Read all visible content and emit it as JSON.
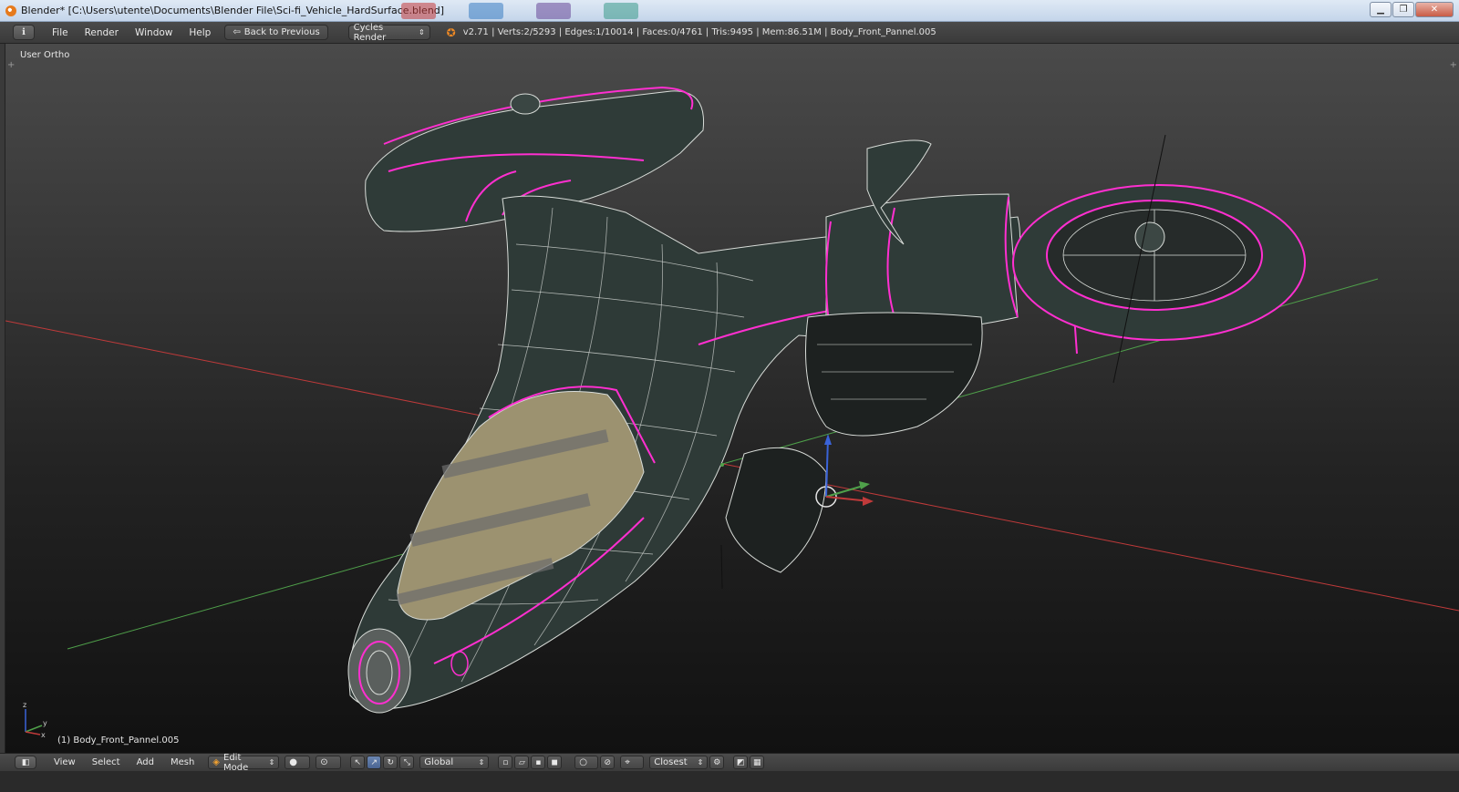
{
  "window": {
    "title": "Blender* [C:\\Users\\utente\\Documents\\Blender File\\Sci-fi_Vehicle_HardSurface.blend]",
    "minimize_icon": "minimize-icon",
    "maximize_icon": "maximize-icon",
    "close_icon": "close-icon",
    "min_glyph": "▁",
    "max_glyph": "❐",
    "close_glyph": "✕"
  },
  "info_header": {
    "editor_icon": "info-icon",
    "editor_glyph": "ℹ",
    "menus": [
      "File",
      "Render",
      "Window",
      "Help"
    ],
    "back_label": "Back to Previous",
    "render_engine": "Cycles Render",
    "stats": "v2.71 | Verts:2/5293 | Edges:1/10014 | Faces:0/4761 | Tris:9495 | Mem:86.51M | Body_Front_Pannel.005"
  },
  "viewport": {
    "view_name": "User Ortho",
    "active_object": "(1) Body_Front_Pannel.005",
    "axis_colors": {
      "x": "#c03a3a",
      "y": "#4fa04a",
      "z": "#3a63d8"
    },
    "wire_color": "#d8dcd8",
    "seam_color": "#ff2fd0",
    "hull_color": "#2f3b38",
    "canopy_color": "#9c9270"
  },
  "view_header": {
    "editor_glyph": "◧",
    "menus": [
      "View",
      "Select",
      "Add",
      "Mesh"
    ],
    "mode": "Edit Mode",
    "pivot": "Global",
    "snap_target": "Closest"
  }
}
